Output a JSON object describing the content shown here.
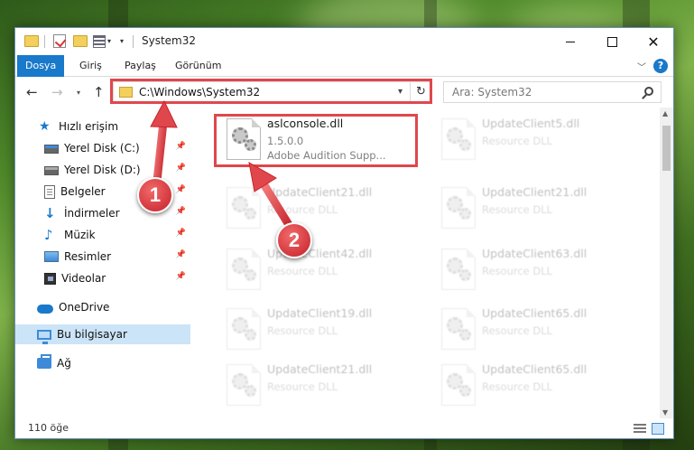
{
  "window": {
    "title": "System32",
    "controls": {
      "minimize": "–",
      "maximize": "□",
      "close": "✕"
    }
  },
  "ribbon": {
    "tabs": [
      {
        "label": "Dosya",
        "active": true
      },
      {
        "label": "Giriş"
      },
      {
        "label": "Paylaş"
      },
      {
        "label": "Görünüm"
      }
    ],
    "help": "?"
  },
  "nav": {
    "back": "←",
    "forward": "→",
    "recent": "▾",
    "up": "↑",
    "address": "C:\\Windows\\System32",
    "refresh": "↻",
    "search_placeholder": "Ara: System32"
  },
  "sidebar": {
    "items": [
      {
        "label": "Hızlı erişim",
        "icon": "star-icon"
      },
      {
        "label": "Yerel Disk (C:)",
        "icon": "disk-icon",
        "pinned": true
      },
      {
        "label": "Yerel Disk (D:)",
        "icon": "disk-icon",
        "pinned": true
      },
      {
        "label": "Belgeler",
        "icon": "documents-icon",
        "pinned": true
      },
      {
        "label": "İndirmeler",
        "icon": "downloads-icon",
        "pinned": true
      },
      {
        "label": "Müzik",
        "icon": "music-icon",
        "pinned": true
      },
      {
        "label": "Resimler",
        "icon": "pictures-icon",
        "pinned": true
      },
      {
        "label": "Videolar",
        "icon": "videos-icon",
        "pinned": true
      },
      {
        "label": "OneDrive",
        "icon": "onedrive-icon"
      },
      {
        "label": "Bu bilgisayar",
        "icon": "this-pc-icon",
        "selected": true
      },
      {
        "label": "Ağ",
        "icon": "network-icon"
      }
    ]
  },
  "files": {
    "highlighted": {
      "name": "aslconsole.dll",
      "version": "1.5.0.0",
      "description": "Adobe Audition Supp..."
    },
    "faded": [
      {
        "name": "UpdateClient5.dll",
        "type": "Resource DLL"
      },
      {
        "name": "UpdateClient21.dll",
        "type": "Resource DLL"
      },
      {
        "name": "UpdateClient21.dll",
        "type": "Resource DLL"
      },
      {
        "name": "UpdateClient42.dll",
        "type": "Resource DLL"
      },
      {
        "name": "UpdateClient63.dll",
        "type": "Resource DLL"
      },
      {
        "name": "UpdateClient19.dll",
        "type": "Resource DLL"
      },
      {
        "name": "UpdateClient65.dll",
        "type": "Resource DLL"
      },
      {
        "name": "UpdateClient21.dll",
        "type": "Resource DLL"
      },
      {
        "name": "UpdateClient65.dll",
        "type": "Resource DLL"
      }
    ]
  },
  "status": {
    "count": "110 öğe"
  },
  "annotations": {
    "step1": "1",
    "step2": "2"
  },
  "colors": {
    "accent": "#1979ca",
    "highlight": "#e0474c",
    "selected": "#cce4f7"
  }
}
